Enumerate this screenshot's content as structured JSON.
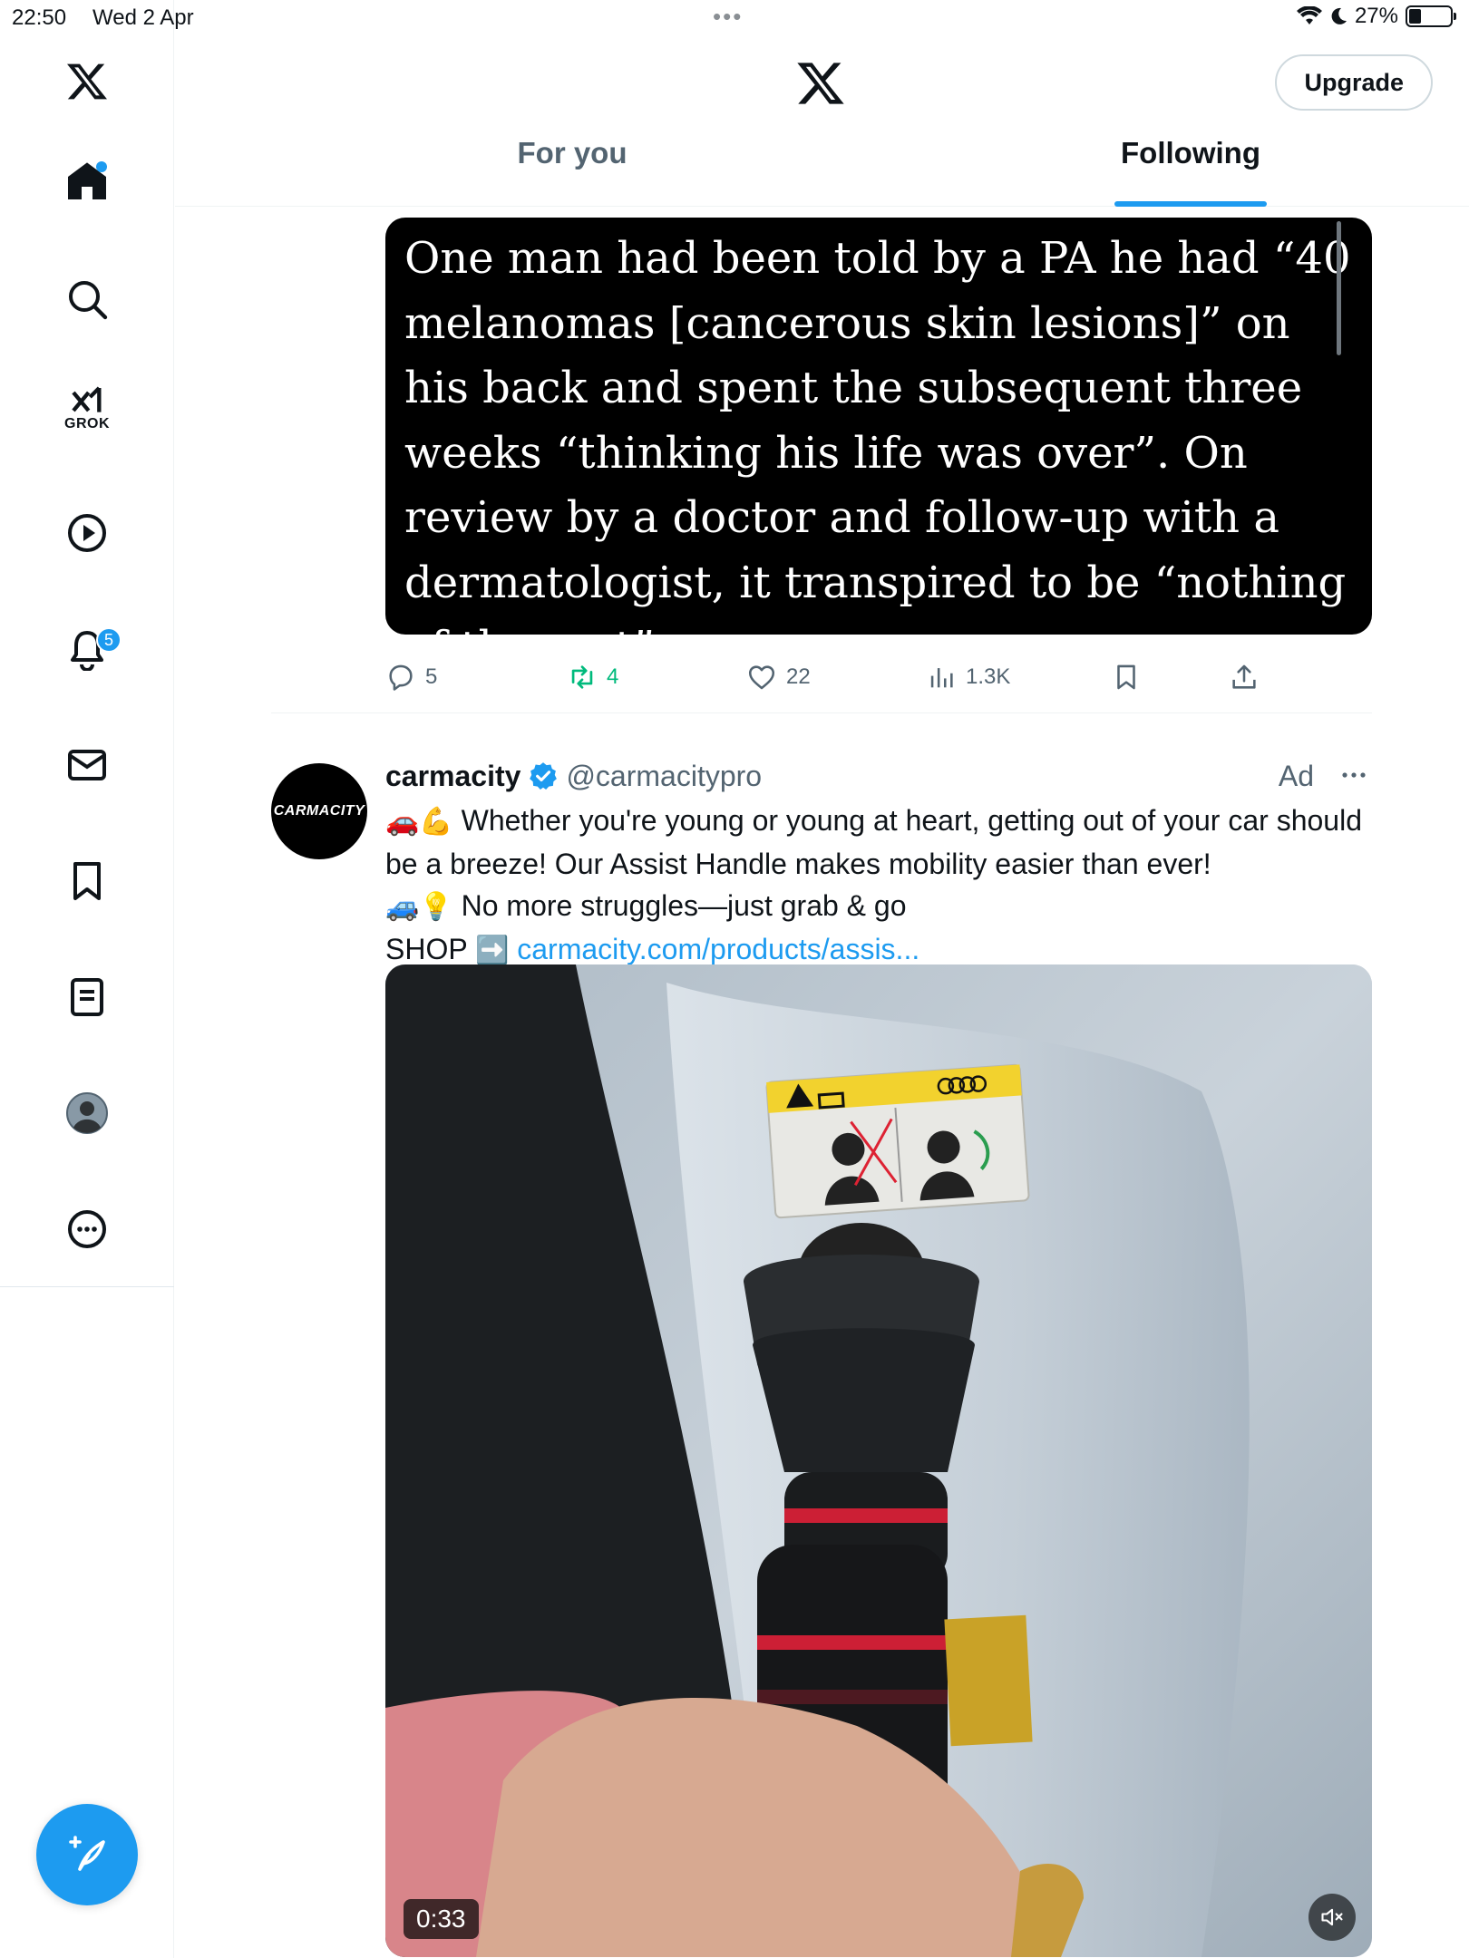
{
  "status_bar": {
    "time": "22:50",
    "date": "Wed 2 Apr",
    "battery": "27%"
  },
  "sidebar": {
    "grok_label": "GROK",
    "notifications_badge": "5"
  },
  "header": {
    "upgrade_label": "Upgrade",
    "tabs": [
      {
        "label": "For you",
        "active": false
      },
      {
        "label": "Following",
        "active": true
      }
    ]
  },
  "quoted_image": {
    "text": "One man had been told by a PA he had “40 melanomas [cancerous skin lesions]” on his back and spent the subsequent three weeks “thinking his life was over”. On review by a doctor and follow-up with a dermatologist, it transpired to be “nothing of the sort”."
  },
  "tweet_actions": {
    "replies": "5",
    "reposts": "4",
    "likes": "22",
    "views": "1.3K"
  },
  "ad_tweet": {
    "avatar_text": "CARMACITY",
    "author_name": "carmacity",
    "handle": "@carmacitypro",
    "ad_label": "Ad",
    "line1_emoji": "🚗💪",
    "line1_text": "Whether you're young or young at heart, getting out of your car should be a breeze! Our Assist Handle makes mobility easier than ever!",
    "line2_emoji": "🚙💡",
    "line2_text": "No more struggles—just grab & go",
    "line3_text": "SHOP",
    "line3_emoji": "➡️",
    "link_text": "carmacity.com/products/assis...",
    "video_duration": "0:33"
  },
  "colors": {
    "accent": "#1d9bf0",
    "repost": "#00ba7c",
    "secondary_text": "#536471"
  }
}
